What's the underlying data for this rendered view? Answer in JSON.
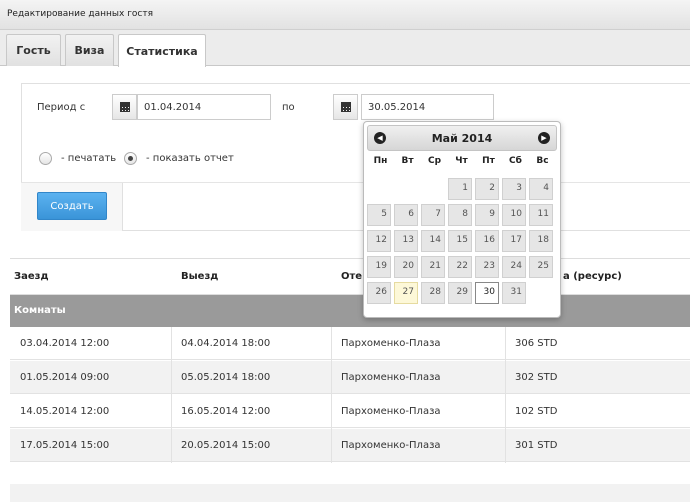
{
  "window": {
    "title": "Редактирование данных гостя"
  },
  "tabs": [
    {
      "label": "Гость"
    },
    {
      "label": "Виза"
    },
    {
      "label": "Статистика"
    }
  ],
  "form": {
    "period_from_label": "Период с",
    "date_from": "01.04.2014",
    "to_label": "по",
    "date_to": "30.05.2014",
    "radio_print_label": "- печатать",
    "radio_show_label": "- показать отчет",
    "radio_selected": "show",
    "create_button": "Создать"
  },
  "datepicker": {
    "prev_icon": "chevron-left-icon",
    "next_icon": "chevron-right-icon",
    "month_title": "Май 2014",
    "weekdays": [
      "Пн",
      "Вт",
      "Ср",
      "Чт",
      "Пт",
      "Сб",
      "Вс"
    ],
    "leading_blanks": 3,
    "days": [
      1,
      2,
      3,
      4,
      5,
      6,
      7,
      8,
      9,
      10,
      11,
      12,
      13,
      14,
      15,
      16,
      17,
      18,
      19,
      20,
      21,
      22,
      23,
      24,
      25,
      26,
      27,
      28,
      29,
      30,
      31
    ],
    "today": 27,
    "selected": 30
  },
  "table": {
    "headers": [
      "Заезд",
      "Выезд",
      "Оте",
      "а (ресурс)"
    ],
    "group_label": "Комнаты",
    "rows": [
      [
        "03.04.2014 12:00",
        "04.04.2014 18:00",
        "Пархоменко-Плаза",
        "306 STD"
      ],
      [
        "01.05.2014 09:00",
        "05.05.2014 18:00",
        "Пархоменко-Плаза",
        "302 STD"
      ],
      [
        "14.05.2014 12:00",
        "16.05.2014 12:00",
        "Пархоменко-Плаза",
        "102 STD"
      ],
      [
        "17.05.2014 15:00",
        "20.05.2014 15:00",
        "Пархоменко-Плаза",
        "301 STD"
      ]
    ]
  }
}
